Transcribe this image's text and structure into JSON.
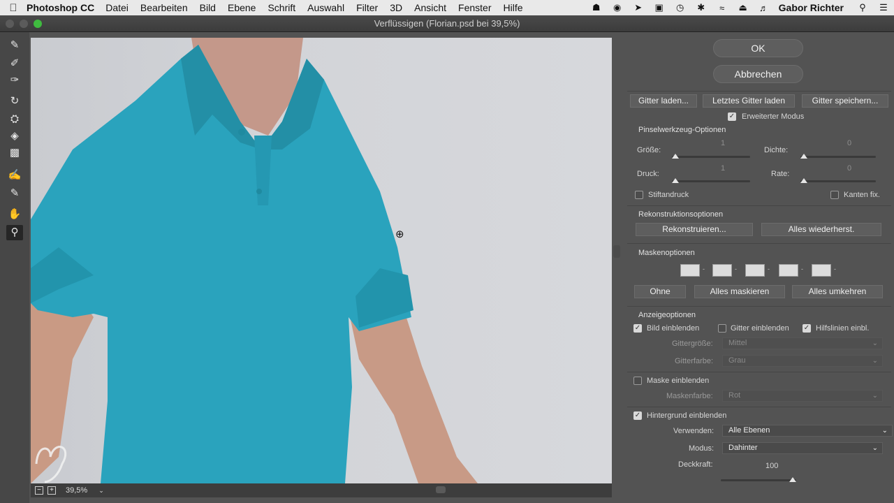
{
  "menubar": {
    "apple": "",
    "app": "Photoshop CC",
    "items": [
      "Datei",
      "Bearbeiten",
      "Bild",
      "Ebene",
      "Schrift",
      "Auswahl",
      "Filter",
      "3D",
      "Ansicht",
      "Fenster",
      "Hilfe"
    ],
    "user": "Gabor Richter"
  },
  "window": {
    "title": "Verflüssigen (Florian.psd bei 39,5%)"
  },
  "status": {
    "zoom": "39,5%"
  },
  "dialog": {
    "ok": "OK",
    "cancel": "Abbrechen",
    "mesh_load": "Gitter laden...",
    "mesh_last": "Letztes Gitter laden",
    "mesh_save": "Gitter speichern...",
    "advanced_mode": "Erweiterter Modus",
    "brush": {
      "title": "Pinselwerkzeug-Optionen",
      "size_label": "Größe:",
      "size_value": "1",
      "density_label": "Dichte:",
      "density_value": "0",
      "pressure_label": "Druck:",
      "pressure_value": "1",
      "rate_label": "Rate:",
      "rate_value": "0",
      "stylus": "Stiftandruck",
      "pin_edges": "Kanten fix."
    },
    "reconstruct": {
      "title": "Rekonstruktionsoptionen",
      "reconstruct": "Rekonstruieren...",
      "restore_all": "Alles wiederherst."
    },
    "mask": {
      "title": "Maskenoptionen",
      "none": "Ohne",
      "mask_all": "Alles maskieren",
      "invert_all": "Alles umkehren"
    },
    "view": {
      "title": "Anzeigeoptionen",
      "show_image": "Bild einblenden",
      "show_mesh": "Gitter einblenden",
      "show_guides": "Hilfslinien einbl.",
      "mesh_size_label": "Gittergröße:",
      "mesh_size_value": "Mittel",
      "mesh_color_label": "Gitterfarbe:",
      "mesh_color_value": "Grau",
      "show_mask": "Maske einblenden",
      "mask_color_label": "Maskenfarbe:",
      "mask_color_value": "Rot",
      "show_backdrop": "Hintergrund einblenden",
      "use_label": "Verwenden:",
      "use_value": "Alle Ebenen",
      "mode_label": "Modus:",
      "mode_value": "Dahinter",
      "opacity_label": "Deckkraft:",
      "opacity_value": "100"
    }
  },
  "colors": {
    "shirt": "#2aa3bd",
    "skin": "#c99a84",
    "backdrop": "#d0d2d6",
    "panel": "#535353"
  }
}
